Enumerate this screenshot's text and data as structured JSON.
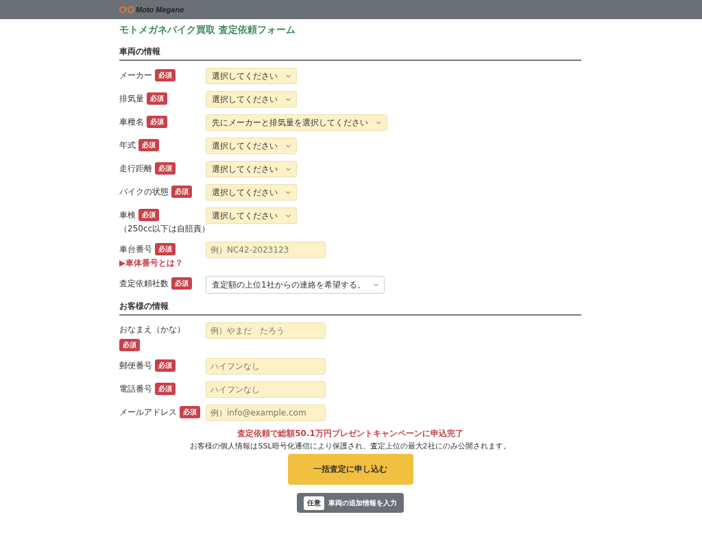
{
  "header": {
    "logo": "Moto Megane"
  },
  "title": "モトメガネバイク買取 査定依頼フォーム",
  "sections": [
    {
      "heading": "車両の情報",
      "rows": [
        {
          "label": "メーカー",
          "badge": "必須",
          "field": {
            "kind": "select",
            "text": "選択してください",
            "answered": false
          }
        },
        {
          "label": "排気量",
          "badge": "必須",
          "field": {
            "kind": "select",
            "text": "選択してください",
            "answered": false
          }
        },
        {
          "label": "車種名",
          "badge": "必須",
          "field": {
            "kind": "select",
            "text": "先にメーカーと排気量を選択してください",
            "answered": false
          }
        },
        {
          "label": "年式",
          "badge": "必須",
          "field": {
            "kind": "select",
            "text": "選択してください",
            "answered": false
          }
        },
        {
          "label": "走行距離",
          "badge": "必須",
          "field": {
            "kind": "select",
            "text": "選択してください",
            "answered": false
          }
        },
        {
          "label": "バイクの状態",
          "badge": "必須",
          "field": {
            "kind": "select",
            "text": "選択してください",
            "answered": false
          }
        },
        {
          "label": "車検",
          "badge": "必須",
          "note": "（250cc以下は自賠責）",
          "field": {
            "kind": "select",
            "text": "選択してください",
            "answered": false
          }
        },
        {
          "label": "車台番号",
          "badge": "必須",
          "link": "▶車体番号とは？",
          "field": {
            "kind": "input",
            "placeholder": "例）NC42-2023123"
          }
        },
        {
          "label": "査定依頼社数",
          "badge": "必須",
          "field": {
            "kind": "select",
            "text": "査定額の上位1社からの連絡を希望する。",
            "answered": true
          }
        }
      ]
    },
    {
      "heading": "お客様の情報",
      "rows": [
        {
          "label": "おなまえ（かな）",
          "badge": "必須",
          "badge_below": true,
          "field": {
            "kind": "input",
            "placeholder": "例）やまだ　たろう"
          }
        },
        {
          "label": "郵便番号",
          "badge": "必須",
          "field": {
            "kind": "input",
            "placeholder": "ハイフンなし"
          }
        },
        {
          "label": "電話番号",
          "badge": "必須",
          "field": {
            "kind": "input",
            "placeholder": "ハイフンなし"
          }
        },
        {
          "label": "メールアドレス",
          "badge": "必須",
          "field": {
            "kind": "input",
            "placeholder": "例）info@example.com"
          }
        }
      ]
    }
  ],
  "campaign": "査定依頼で総額50.1万円プレゼントキャンペーンに申込完了",
  "privacy": "お客様の個人情報はSSL暗号化通信により保護され、査定上位の最大2社にのみ公開されます。",
  "submit": "一括査定に申し込む",
  "optional": {
    "tag": "任意",
    "label": "車両の追加情報を入力"
  }
}
